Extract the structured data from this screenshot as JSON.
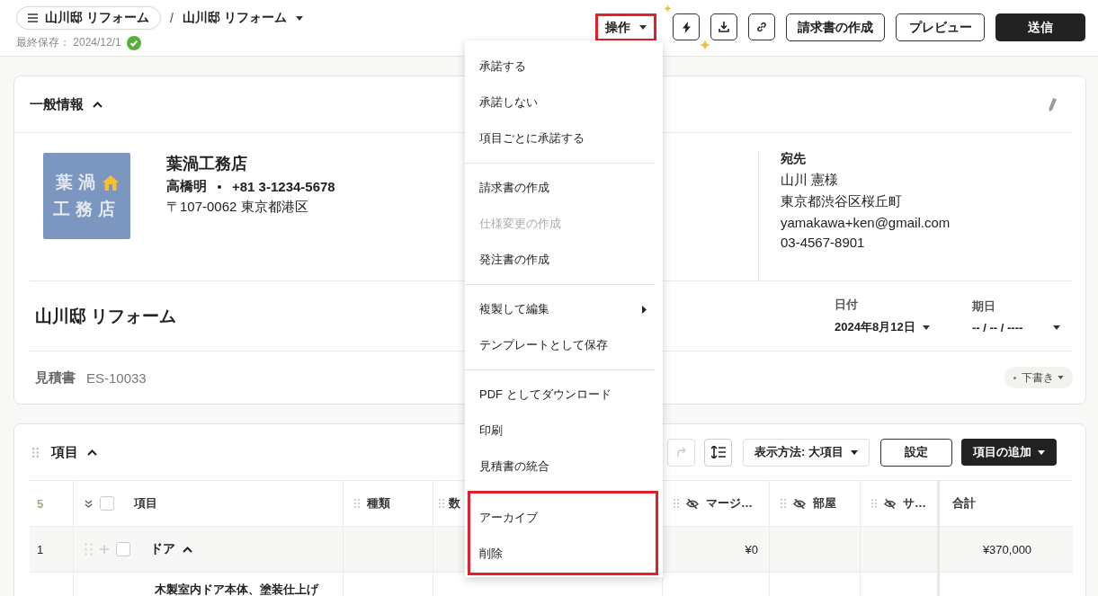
{
  "header": {
    "project_pill": "山川邸 リフォーム",
    "separator": "/",
    "title": "山川邸 リフォーム",
    "last_saved": "最終保存： 2024/12/1",
    "saved": true,
    "actions_button": {
      "label": "操作",
      "highlighted": true
    },
    "icon_buttons": [
      {
        "kind": "bolt"
      },
      {
        "kind": "download"
      },
      {
        "kind": "link"
      }
    ],
    "buttons": [
      {
        "label": "請求書の作成",
        "kind": "outline"
      },
      {
        "label": "プレビュー",
        "kind": "outline"
      },
      {
        "label": "送信",
        "kind": "primary"
      }
    ]
  },
  "menu": {
    "groups": [
      {
        "highlighted": false,
        "items": [
          {
            "label": "承諾する",
            "disabled": false,
            "submenu": false
          },
          {
            "label": "承諾しない",
            "disabled": false,
            "submenu": false
          },
          {
            "label": "項目ごとに承諾する",
            "disabled": false,
            "submenu": false
          }
        ]
      },
      {
        "highlighted": false,
        "items": [
          {
            "label": "請求書の作成",
            "disabled": false,
            "submenu": false
          },
          {
            "label": "仕様変更の作成",
            "disabled": true,
            "submenu": false
          },
          {
            "label": "発注書の作成",
            "disabled": false,
            "submenu": false
          }
        ]
      },
      {
        "highlighted": false,
        "items": [
          {
            "label": "複製して編集",
            "disabled": false,
            "submenu": true
          },
          {
            "label": "テンプレートとして保存",
            "disabled": false,
            "submenu": false
          }
        ]
      },
      {
        "highlighted": false,
        "items": [
          {
            "label": "PDF としてダウンロード",
            "disabled": false,
            "submenu": false
          },
          {
            "label": "印刷",
            "disabled": false,
            "submenu": false
          },
          {
            "label": "見積書の統合",
            "disabled": false,
            "submenu": false
          }
        ]
      },
      {
        "highlighted": true,
        "items": [
          {
            "label": "アーカイブ",
            "disabled": false,
            "submenu": false
          },
          {
            "label": "削除",
            "disabled": false,
            "submenu": false
          }
        ]
      }
    ]
  },
  "general_info": {
    "title": "一般情報",
    "expanded": true,
    "company": {
      "logo_lines": [
        "葉渦",
        "工務店"
      ],
      "name": "葉渦工務店",
      "contact_person": "高橋明",
      "phone": "+81 3-1234-5678",
      "address": "〒107-0062 東京都港区"
    },
    "recipient": {
      "heading": "宛先",
      "name": "山川 憲様",
      "address": "東京都渋谷区桜丘町",
      "email": "yamakawa+ken@gmail.com",
      "phone": "03-4567-8901"
    },
    "project_title": "山川邸 リフォーム",
    "dates": [
      {
        "label": "日付",
        "value": "2024年8月12日"
      },
      {
        "label": "期日",
        "value": "-- / -- / ----"
      }
    ],
    "doc_type": "見積書",
    "doc_number": "ES-10033",
    "status": "下書き"
  },
  "items_section": {
    "title": "項目",
    "expanded": true,
    "view_select": "表示方法: 大項目",
    "settings_button": "設定",
    "add_button": "項目の追加",
    "table": {
      "count": "5",
      "select_all_checked": false,
      "columns": [
        {
          "label": "項目",
          "draggable": false,
          "hidden": false
        },
        {
          "label": "種類",
          "draggable": true,
          "hidden": false
        },
        {
          "label": "数",
          "draggable": true,
          "hidden": false
        },
        {
          "label": "マージ…",
          "draggable": true,
          "hidden": true
        },
        {
          "label": "部屋",
          "draggable": true,
          "hidden": true
        },
        {
          "label": "サ…",
          "draggable": true,
          "hidden": true
        },
        {
          "label": "合計",
          "draggable": false,
          "hidden": false
        }
      ],
      "rows": [
        {
          "kind": "group",
          "number": "1",
          "checked": false,
          "expanded": true,
          "cells": [
            "ドア",
            "",
            "",
            "¥0",
            "",
            "",
            "¥370,000"
          ]
        },
        {
          "kind": "item",
          "cells": [
            "木製室内ドア本体、塗装仕上げ",
            "",
            "",
            "",
            "",
            "",
            ""
          ]
        }
      ]
    }
  }
}
